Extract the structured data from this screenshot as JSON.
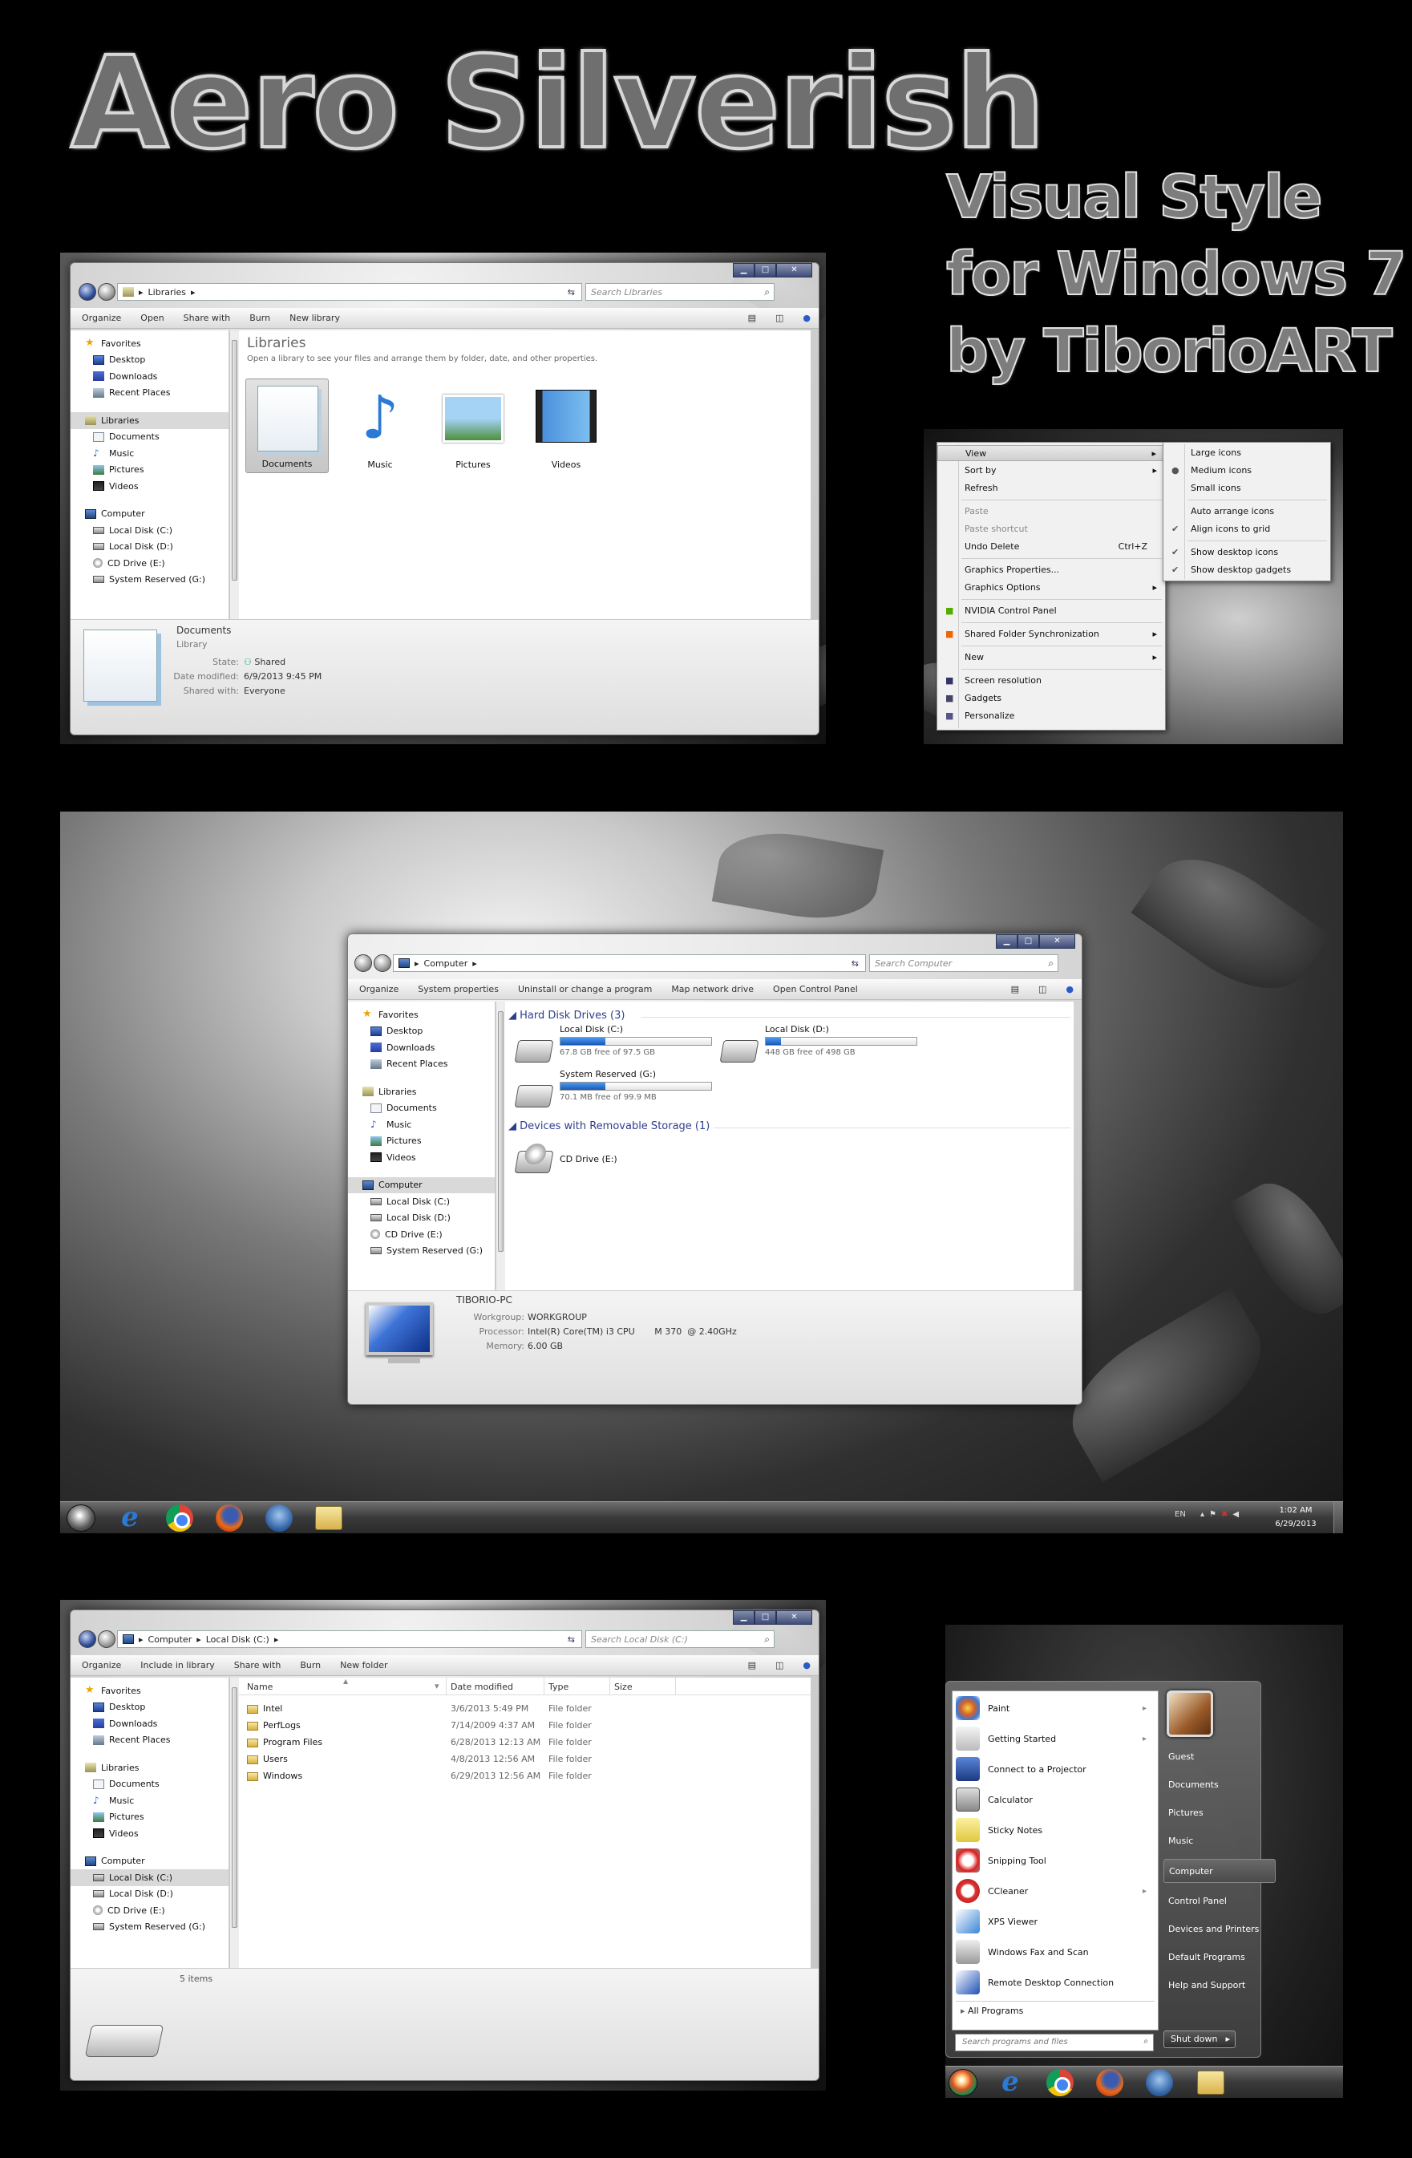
{
  "title": "Aero Silverish",
  "subtitle_lines": [
    "Visual Style",
    "for Windows 7",
    "by TiborioART"
  ],
  "lib_window": {
    "address": "Libraries",
    "search_placeholder": "Search Libraries",
    "toolbar": [
      "Organize",
      "Open",
      "Share with",
      "Burn",
      "New library"
    ],
    "nav": {
      "favorites": "Favorites",
      "desktop": "Desktop",
      "downloads": "Downloads",
      "recent": "Recent Places",
      "libraries": "Libraries",
      "documents": "Documents",
      "music": "Music",
      "pictures": "Pictures",
      "videos": "Videos",
      "computer": "Computer",
      "c": "Local Disk (C:)",
      "d": "Local Disk (D:)",
      "e": "CD Drive (E:)",
      "g": "System Reserved (G:)"
    },
    "heading": "Libraries",
    "description": "Open a library to see your files and arrange them by folder, date, and other properties.",
    "items": [
      "Documents",
      "Music",
      "Pictures",
      "Videos"
    ],
    "details": {
      "name": "Documents",
      "type": "Library",
      "state_label": "State:",
      "state_value": "Shared",
      "modified_label": "Date modified:",
      "modified_value": "6/9/2013 9:45 PM",
      "shared_label": "Shared with:",
      "shared_value": "Everyone"
    }
  },
  "context_menu": {
    "items": [
      "View",
      "Sort by",
      "Refresh",
      "Paste",
      "Paste shortcut",
      "Undo Delete",
      "Graphics Properties...",
      "Graphics Options",
      "NVIDIA Control Panel",
      "Shared Folder Synchronization",
      "New",
      "Screen resolution",
      "Gadgets",
      "Personalize"
    ],
    "undo_shortcut": "Ctrl+Z",
    "submenu": [
      "Large icons",
      "Medium icons",
      "Small icons",
      "Auto arrange icons",
      "Align icons to grid",
      "Show desktop icons",
      "Show desktop gadgets"
    ]
  },
  "computer_window": {
    "address": "Computer",
    "search_placeholder": "Search Computer",
    "toolbar": [
      "Organize",
      "System properties",
      "Uninstall or change a program",
      "Map network drive",
      "Open Control Panel"
    ],
    "nav": {
      "favorites": "Favorites",
      "desktop": "Desktop",
      "downloads": "Downloads",
      "recent": "Recent Places",
      "libraries": "Libraries",
      "documents": "Documents",
      "music": "Music",
      "pictures": "Pictures",
      "videos": "Videos",
      "computer": "Computer",
      "c": "Local Disk (C:)",
      "d": "Local Disk (D:)",
      "e": "CD Drive (E:)",
      "g": "System Reserved (G:)"
    },
    "hdd_heading": "Hard Disk Drives (3)",
    "removable_heading": "Devices with Removable Storage (1)",
    "drives": [
      {
        "name": "Local Disk (C:)",
        "free": "67.8 GB free of 97.5 GB",
        "used": 0.3
      },
      {
        "name": "Local Disk (D:)",
        "free": "448 GB free of 498 GB",
        "used": 0.1
      },
      {
        "name": "System Reserved (G:)",
        "free": "70.1 MB free of 99.9 MB",
        "used": 0.3
      }
    ],
    "cd": "CD Drive (E:)",
    "details": {
      "pc": "TIBORIO-PC",
      "wg_label": "Workgroup:",
      "wg_value": "WORKGROUP",
      "proc_label": "Processor:",
      "proc_value": "Intel(R) Core(TM) i3 CPU       M 370  @ 2.40GHz",
      "mem_label": "Memory:",
      "mem_value": "6.00 GB"
    }
  },
  "taskbar": {
    "lang": "EN",
    "time": "1:02 AM",
    "date": "6/29/2013"
  },
  "disk_window": {
    "address_parts": [
      "Computer",
      "Local Disk (C:)"
    ],
    "search_placeholder": "Search Local Disk (C:)",
    "toolbar": [
      "Organize",
      "Include in library",
      "Share with",
      "Burn",
      "New folder"
    ],
    "nav": {
      "favorites": "Favorites",
      "desktop": "Desktop",
      "downloads": "Downloads",
      "recent": "Recent Places",
      "libraries": "Libraries",
      "documents": "Documents",
      "music": "Music",
      "pictures": "Pictures",
      "videos": "Videos",
      "computer": "Computer",
      "c": "Local Disk (C:)",
      "d": "Local Disk (D:)",
      "e": "CD Drive (E:)",
      "g": "System Reserved (G:)"
    },
    "columns": [
      "Name",
      "Date modified",
      "Type",
      "Size"
    ],
    "rows": [
      {
        "name": "Intel",
        "date": "3/6/2013 5:49 PM",
        "type": "File folder"
      },
      {
        "name": "PerfLogs",
        "date": "7/14/2009 4:37 AM",
        "type": "File folder"
      },
      {
        "name": "Program Files",
        "date": "6/28/2013 12:13 AM",
        "type": "File folder"
      },
      {
        "name": "Users",
        "date": "4/8/2013 12:56 AM",
        "type": "File folder"
      },
      {
        "name": "Windows",
        "date": "6/29/2013 12:56 AM",
        "type": "File folder"
      }
    ],
    "item_count": "5 items"
  },
  "start_menu": {
    "programs": [
      "Paint",
      "Getting Started",
      "Connect to a Projector",
      "Calculator",
      "Sticky Notes",
      "Snipping Tool",
      "CCleaner",
      "XPS Viewer",
      "Windows Fax and Scan",
      "Remote Desktop Connection"
    ],
    "all_programs": "All Programs",
    "search_placeholder": "Search programs and files",
    "right": [
      "Guest",
      "Documents",
      "Pictures",
      "Music",
      "Computer",
      "Control Panel",
      "Devices and Printers",
      "Default Programs",
      "Help and Support"
    ],
    "shutdown": "Shut down"
  }
}
